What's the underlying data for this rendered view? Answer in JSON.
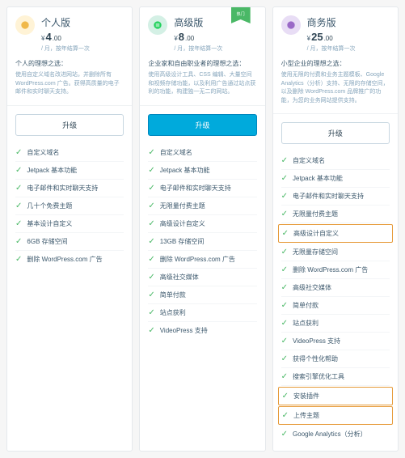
{
  "plans": [
    {
      "name": "个人版",
      "price": "4",
      "priceSub": ".00",
      "billing": "/ 月，按年结算一次",
      "descTitle": "个人的理想之选：",
      "descText": "使用自定义域名改进网站，并删除所有 WordPress.com 广告。获得高质量的电子邮件和实时聊天支持。",
      "btn": "升级",
      "btnPrimary": false,
      "features": [
        {
          "t": "自定义域名"
        },
        {
          "t": "Jetpack 基本功能"
        },
        {
          "t": "电子邮件和实时聊天支持"
        },
        {
          "t": "几十个免费主题"
        },
        {
          "t": "基本设计自定义"
        },
        {
          "t": "6GB 存储空间"
        },
        {
          "t": "删除 WordPress.com 广告"
        }
      ]
    },
    {
      "name": "高级版",
      "price": "8",
      "priceSub": ".00",
      "billing": "/ 月，按年结算一次",
      "descTitle": "企业家和自由职业者的理想之选：",
      "descText": "使用高级设计工具、CSS 编辑、大量空间和视频存储功能，以及利用广告通过站点获利的功能，构建独一无二的网站。",
      "btn": "升级",
      "btnPrimary": true,
      "badge": "热门",
      "features": [
        {
          "t": "自定义域名"
        },
        {
          "t": "Jetpack 基本功能"
        },
        {
          "t": "电子邮件和实时聊天支持"
        },
        {
          "t": "无限量付费主题"
        },
        {
          "t": "高级设计自定义"
        },
        {
          "t": "13GB 存储空间"
        },
        {
          "t": "删除 WordPress.com 广告"
        },
        {
          "t": "高级社交媒体"
        },
        {
          "t": "简单付款"
        },
        {
          "t": "站点获利"
        },
        {
          "t": "VideoPress 支持"
        }
      ]
    },
    {
      "name": "商务版",
      "price": "25",
      "priceSub": ".00",
      "billing": "/ 月，按年结算一次",
      "descTitle": "小型企业的理想之选：",
      "descText": "使用无限的付费和业务主题模板、Google Analytics（分析）支持、无限的存储空间，以及删除 WordPress.com 品牌推广的功能，为您的业务网站提供支持。",
      "btn": "升级",
      "btnPrimary": false,
      "features": [
        {
          "t": "自定义域名"
        },
        {
          "t": "Jetpack 基本功能"
        },
        {
          "t": "电子邮件和实时聊天支持"
        },
        {
          "t": "无限量付费主题"
        },
        {
          "t": "高级设计自定义",
          "hl": true
        },
        {
          "t": "无限量存储空间"
        },
        {
          "t": "删除 WordPress.com 广告"
        },
        {
          "t": "高级社交媒体"
        },
        {
          "t": "简单付款"
        },
        {
          "t": "站点获利"
        },
        {
          "t": "VideoPress 支持"
        },
        {
          "t": "获得个性化帮助"
        },
        {
          "t": "搜索引擎优化工具"
        },
        {
          "t": "安装插件",
          "hl": true
        },
        {
          "t": "上传主题",
          "hl": true
        },
        {
          "t": "Google Analytics（分析）"
        }
      ]
    }
  ]
}
